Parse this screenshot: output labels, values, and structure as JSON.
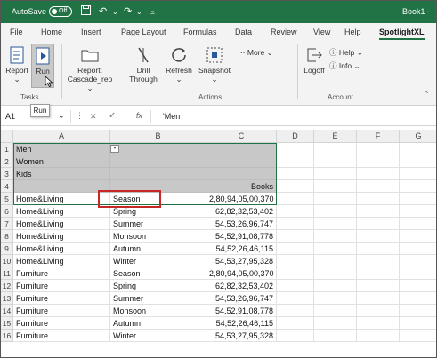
{
  "titlebar": {
    "autosave_label": "AutoSave",
    "autosave_state": "Off",
    "book": "Book1 -"
  },
  "menu": [
    "File",
    "Home",
    "Insert",
    "Page Layout",
    "Formulas",
    "Data",
    "Review",
    "View",
    "Help",
    "SpotlightXL"
  ],
  "active_menu": "SpotlightXL",
  "ribbon": {
    "report": "Report",
    "run": "Run",
    "report_cascade_line1": "Report:",
    "report_cascade_line2": "Cascade_rep",
    "drill_line1": "Drill",
    "drill_line2": "Through",
    "refresh": "Refresh",
    "snapshot": "Snapshot",
    "more": "More",
    "logoff": "Logoff",
    "help": "Help",
    "info": "Info",
    "group_tasks": "Tasks",
    "group_actions": "Actions",
    "group_account": "Account"
  },
  "tooltip": "Run",
  "formula_bar": {
    "name_box": "A1",
    "fx": "fx",
    "formula": "'Men"
  },
  "columns": [
    "A",
    "B",
    "C",
    "D",
    "E",
    "F",
    "G"
  ],
  "rows": [
    {
      "n": "1",
      "a": "Men",
      "b": "",
      "c": ""
    },
    {
      "n": "2",
      "a": "Women",
      "b": "",
      "c": ""
    },
    {
      "n": "3",
      "a": "Kids",
      "b": "",
      "c": ""
    },
    {
      "n": "4",
      "a": "",
      "b": "",
      "c": "Books"
    },
    {
      "n": "5",
      "a": "Home&Living",
      "b": "Season",
      "c": "2,80,94,05,00,370"
    },
    {
      "n": "6",
      "a": "Home&Living",
      "b": "Spring",
      "c": "62,82,32,53,402"
    },
    {
      "n": "7",
      "a": "Home&Living",
      "b": "Summer",
      "c": "54,53,26,96,747"
    },
    {
      "n": "8",
      "a": "Home&Living",
      "b": "Monsoon",
      "c": "54,52,91,08,778"
    },
    {
      "n": "9",
      "a": "Home&Living",
      "b": "Autumn",
      "c": "54,52,26,46,115"
    },
    {
      "n": "10",
      "a": "Home&Living",
      "b": "Winter",
      "c": "54,53,27,95,328"
    },
    {
      "n": "11",
      "a": "Furniture",
      "b": "Season",
      "c": "2,80,94,05,00,370"
    },
    {
      "n": "12",
      "a": "Furniture",
      "b": "Spring",
      "c": "62,82,32,53,402"
    },
    {
      "n": "13",
      "a": "Furniture",
      "b": "Summer",
      "c": "54,53,26,96,747"
    },
    {
      "n": "14",
      "a": "Furniture",
      "b": "Monsoon",
      "c": "54,52,91,08,778"
    },
    {
      "n": "15",
      "a": "Furniture",
      "b": "Autumn",
      "c": "54,52,26,46,115"
    },
    {
      "n": "16",
      "a": "Furniture",
      "b": "Winter",
      "c": "54,53,27,95,328"
    }
  ],
  "colors": {
    "brand_green": "#217346",
    "header_gray": "#c8c8c8",
    "highlight_red": "#c62828"
  }
}
